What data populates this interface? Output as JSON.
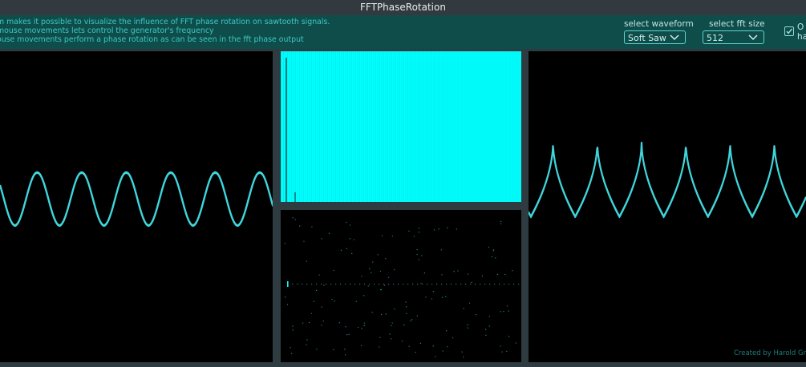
{
  "window": {
    "title": "FFTPhaseRotation"
  },
  "header": {
    "description": [
      "m makes it possible to visualize the influence of FFT phase rotation on sawtooth signals.",
      " mouse movements lets control the generator's frequency",
      "ouse movements perform a phase rotation as can be seen in the fft phase output"
    ],
    "waveform_label": "select waveform",
    "waveform_value": "Soft Saw",
    "fft_label": "select fft size",
    "fft_value": "512",
    "checkbox_label_1": "O",
    "checkbox_label_2": "ha",
    "checkbox_checked": true
  },
  "footer": {
    "credit": "Created by Harold Gn"
  },
  "colors": {
    "accent": "#00ffff",
    "trace": "#3fd6dc",
    "panel_bg": "#000000",
    "frame": "#2e3b40",
    "topbar": "#0e4d4a"
  }
}
